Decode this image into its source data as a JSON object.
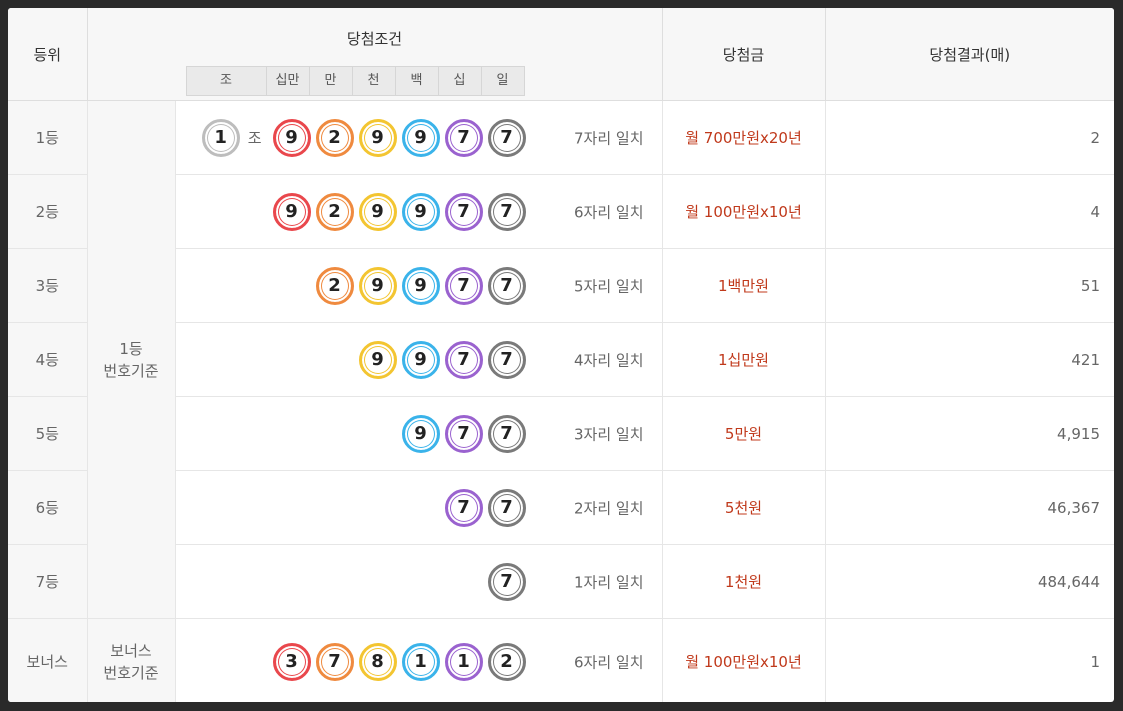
{
  "header": {
    "rank": "등위",
    "condition": "당첨조건",
    "prize": "당첨금",
    "result": "당첨결과(매)",
    "digits": [
      "조",
      "십만",
      "만",
      "천",
      "백",
      "십",
      "일"
    ]
  },
  "basis": {
    "main": [
      "1등",
      "번호기준"
    ],
    "bonus": [
      "보너스",
      "번호기준"
    ]
  },
  "jo_label": "조",
  "colors": {
    "red": "#e9474c",
    "orange": "#ef8a3f",
    "yellow": "#f3c531",
    "blue": "#3ab3ea",
    "purple": "#9a62cf",
    "gray": "#7a7a7a",
    "prize_text": "#c0391b"
  },
  "rows": [
    {
      "rank": "1등",
      "group": "1",
      "balls": [
        {
          "d": "9",
          "c": "red"
        },
        {
          "d": "2",
          "c": "orange"
        },
        {
          "d": "9",
          "c": "yellow"
        },
        {
          "d": "9",
          "c": "blue"
        },
        {
          "d": "7",
          "c": "purple"
        },
        {
          "d": "7",
          "c": "gray"
        }
      ],
      "match": "7자리 일치",
      "prize": "월 700만원x20년",
      "count": "2"
    },
    {
      "rank": "2등",
      "balls": [
        {
          "d": "9",
          "c": "red"
        },
        {
          "d": "2",
          "c": "orange"
        },
        {
          "d": "9",
          "c": "yellow"
        },
        {
          "d": "9",
          "c": "blue"
        },
        {
          "d": "7",
          "c": "purple"
        },
        {
          "d": "7",
          "c": "gray"
        }
      ],
      "match": "6자리 일치",
      "prize": "월 100만원x10년",
      "count": "4"
    },
    {
      "rank": "3등",
      "balls": [
        {
          "d": "2",
          "c": "orange"
        },
        {
          "d": "9",
          "c": "yellow"
        },
        {
          "d": "9",
          "c": "blue"
        },
        {
          "d": "7",
          "c": "purple"
        },
        {
          "d": "7",
          "c": "gray"
        }
      ],
      "match": "5자리 일치",
      "prize": "1백만원",
      "count": "51"
    },
    {
      "rank": "4등",
      "balls": [
        {
          "d": "9",
          "c": "yellow"
        },
        {
          "d": "9",
          "c": "blue"
        },
        {
          "d": "7",
          "c": "purple"
        },
        {
          "d": "7",
          "c": "gray"
        }
      ],
      "match": "4자리 일치",
      "prize": "1십만원",
      "count": "421"
    },
    {
      "rank": "5등",
      "balls": [
        {
          "d": "9",
          "c": "blue"
        },
        {
          "d": "7",
          "c": "purple"
        },
        {
          "d": "7",
          "c": "gray"
        }
      ],
      "match": "3자리 일치",
      "prize": "5만원",
      "count": "4,915"
    },
    {
      "rank": "6등",
      "balls": [
        {
          "d": "7",
          "c": "purple"
        },
        {
          "d": "7",
          "c": "gray"
        }
      ],
      "match": "2자리 일치",
      "prize": "5천원",
      "count": "46,367"
    },
    {
      "rank": "7등",
      "balls": [
        {
          "d": "7",
          "c": "gray"
        }
      ],
      "match": "1자리 일치",
      "prize": "1천원",
      "count": "484,644"
    }
  ],
  "bonus_row": {
    "rank": "보너스",
    "balls": [
      {
        "d": "3",
        "c": "red"
      },
      {
        "d": "7",
        "c": "orange"
      },
      {
        "d": "8",
        "c": "yellow"
      },
      {
        "d": "1",
        "c": "blue"
      },
      {
        "d": "1",
        "c": "purple"
      },
      {
        "d": "2",
        "c": "gray"
      }
    ],
    "match": "6자리 일치",
    "prize": "월 100만원x10년",
    "count": "1"
  }
}
